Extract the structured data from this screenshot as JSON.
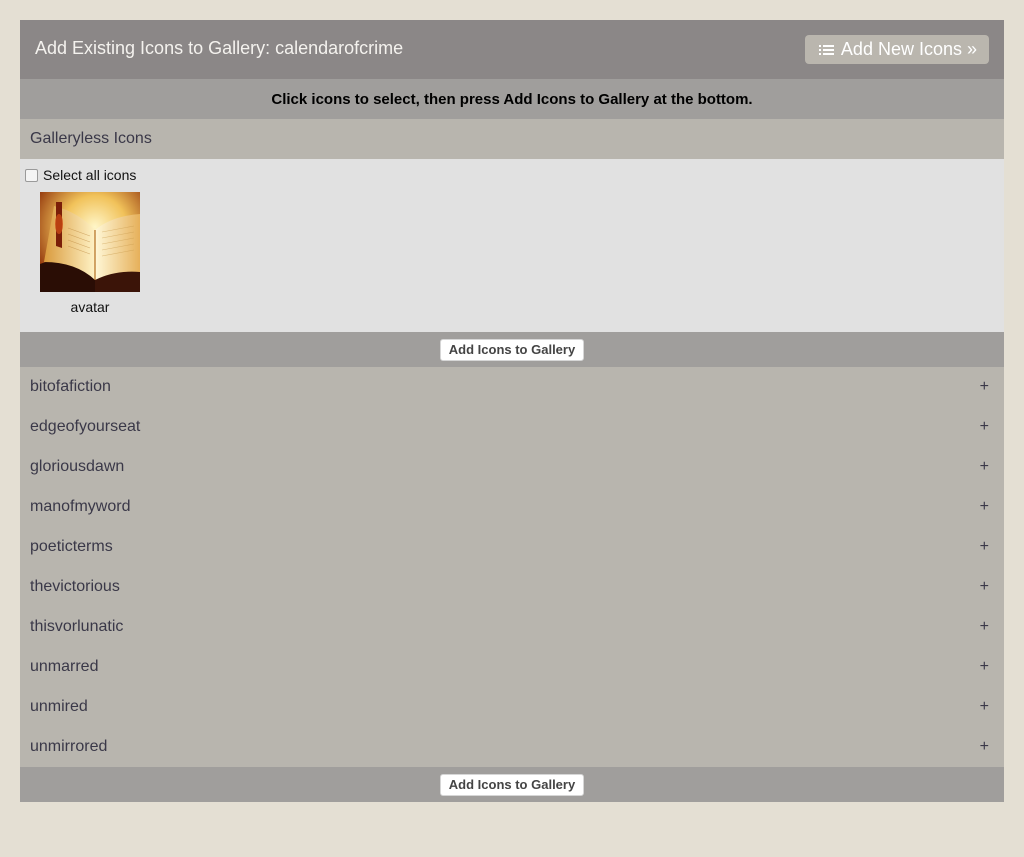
{
  "header": {
    "title": "Add Existing Icons to Gallery: calendarofcrime",
    "add_new_label": "Add New Icons »"
  },
  "instructions": "Click icons to select, then press Add Icons to Gallery at the bottom.",
  "galleryless": {
    "title": "Galleryless Icons",
    "select_all_label": "Select all icons",
    "icons": [
      {
        "label": "avatar",
        "icon": "open-book-image"
      }
    ]
  },
  "actions": {
    "add_to_gallery_label": "Add Icons to Gallery"
  },
  "galleries": [
    {
      "name": "bitofafiction",
      "toggle": "+"
    },
    {
      "name": "edgeofyourseat",
      "toggle": "+"
    },
    {
      "name": "gloriousdawn",
      "toggle": "+"
    },
    {
      "name": "manofmyword",
      "toggle": "+"
    },
    {
      "name": "poeticterms",
      "toggle": "+"
    },
    {
      "name": "thevictorious",
      "toggle": "+"
    },
    {
      "name": "thisvorlunatic",
      "toggle": "+"
    },
    {
      "name": "unmarred",
      "toggle": "+"
    },
    {
      "name": "unmired",
      "toggle": "+"
    },
    {
      "name": "unmirrored",
      "toggle": "+"
    }
  ],
  "colors": {
    "page_background": "#e4dfd3",
    "header_background": "#8b8787",
    "instruction_background": "#a09e9c",
    "section_background": "#b8b5ae",
    "icons_area_background": "#e1e1e1"
  }
}
